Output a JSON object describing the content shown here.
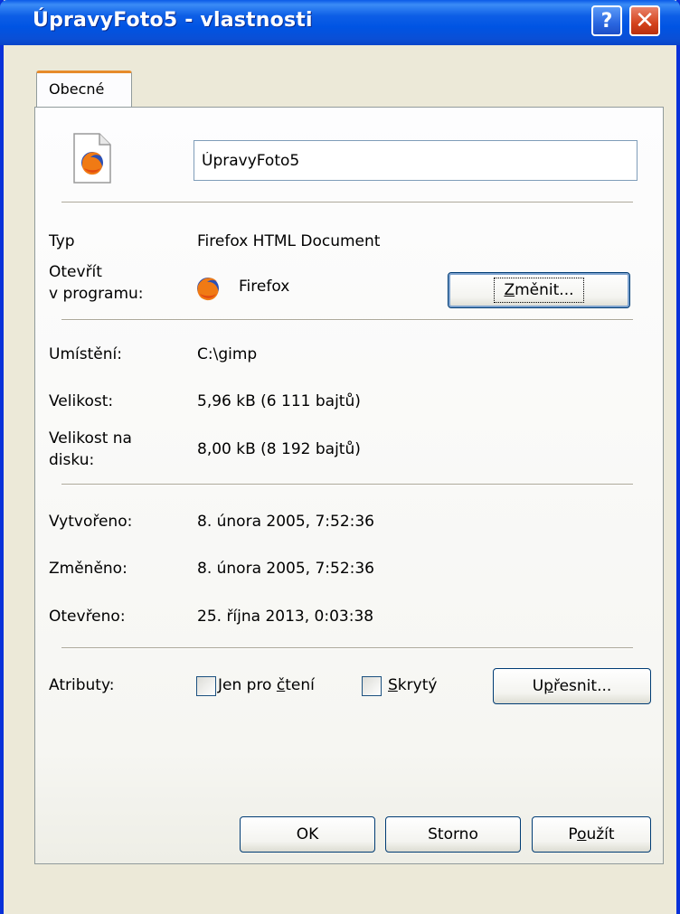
{
  "window": {
    "title": "ÚpravyFoto5 - vlastnosti",
    "help_label": "?",
    "close_label": "✕"
  },
  "tabs": [
    {
      "label": "Obecné",
      "active": true
    }
  ],
  "general": {
    "file_name": "ÚpravyFoto5",
    "type_label": "Typ",
    "type_value": "Firefox HTML Document",
    "open_with_label_1": "Otevřít",
    "open_with_label_2": "v programu:",
    "open_with_value": "Firefox",
    "change_button": {
      "pre": "",
      "accel": "Z",
      "post": "měnit..."
    },
    "location_label": "Umístění:",
    "location_value": "C:\\gimp",
    "size_label": "Velikost:",
    "size_value": "5,96 kB (6 111 bajtů)",
    "size_on_disk_label_1": "Velikost na",
    "size_on_disk_label_2": "disku:",
    "size_on_disk_value": "8,00 kB (8 192 bajtů)",
    "created_label": "Vytvořeno:",
    "created_value": "8. února 2005, 7:52:36",
    "modified_label": "Změněno:",
    "modified_value": "8. února 2005, 7:52:36",
    "accessed_label": "Otevřeno:",
    "accessed_value": "25. října 2013, 0:03:38",
    "attributes_label": "Atributy:",
    "readonly": {
      "pre": "Jen pro ",
      "accel": "č",
      "post": "tení",
      "checked": false
    },
    "hidden": {
      "pre": "",
      "accel": "S",
      "post": "krytý",
      "checked": false
    },
    "advanced_button": {
      "pre": "U",
      "accel": "p",
      "post": "řesnit..."
    }
  },
  "footer": {
    "ok_label": "OK",
    "cancel_label": "Storno",
    "apply_button": {
      "pre": "P",
      "accel": "o",
      "post": "užít"
    }
  },
  "colors": {
    "titlebar": "#0054e3",
    "dialog_bg": "#ece9d8",
    "tab_accent": "#e68b2c",
    "close_red": "#d4431c"
  }
}
